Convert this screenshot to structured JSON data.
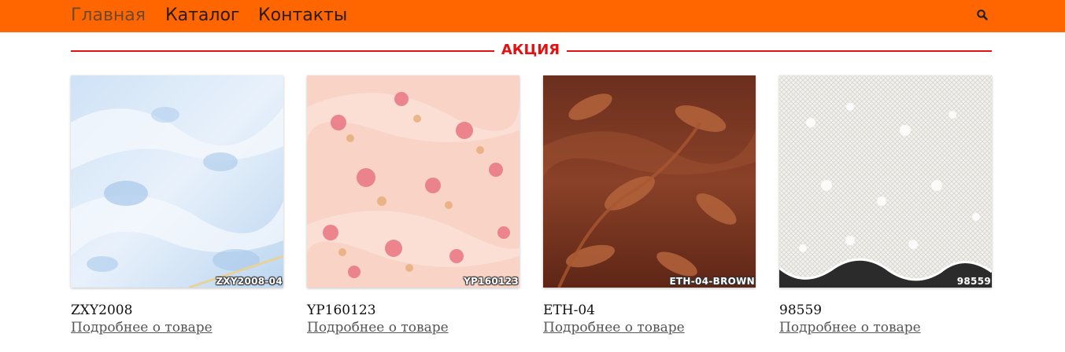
{
  "nav": {
    "items": [
      {
        "label": "Главная",
        "active": true
      },
      {
        "label": "Каталог",
        "active": false
      },
      {
        "label": "Контакты",
        "active": false
      }
    ],
    "search_icon": "search-icon",
    "bar_color": "#ff6600"
  },
  "section": {
    "title": "АКЦИЯ",
    "accent_color": "#e31111"
  },
  "products": [
    {
      "name": "ZXY2008",
      "image_sku": "ZXY2008-04",
      "link_label": "Подробнее о товаре",
      "image": "light blue patterned fabric"
    },
    {
      "name": "YP160123",
      "image_sku": "YP160123",
      "link_label": "Подробнее о товаре",
      "image": "pink floral fabric"
    },
    {
      "name": "ETH-04",
      "image_sku": "ETH-04-BROWN",
      "link_label": "Подробнее о товаре",
      "image": "brown leaf pattern fabric"
    },
    {
      "name": "98559",
      "image_sku": "98559",
      "link_label": "Подробнее о товаре",
      "image": "white lace curtain"
    }
  ]
}
